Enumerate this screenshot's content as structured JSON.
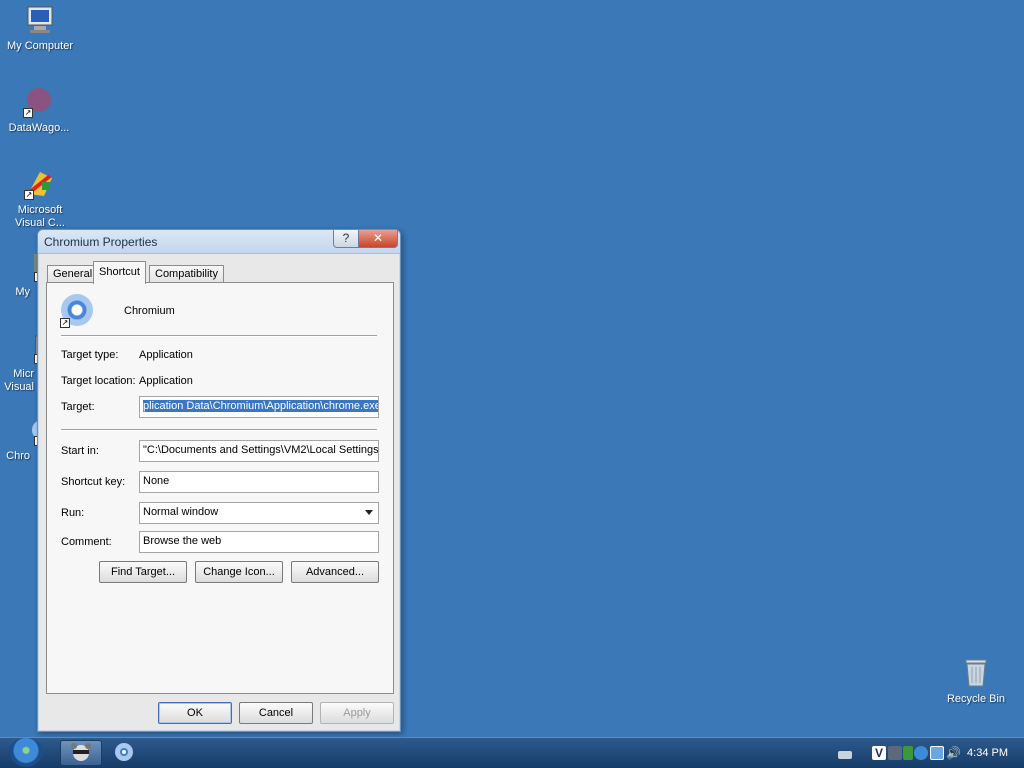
{
  "desktop": {
    "icons": [
      {
        "label": "My Computer",
        "icon": "computer-icon"
      },
      {
        "label": "DataWago...",
        "icon": "datawagon-icon"
      },
      {
        "label": "Microsoft Visual C...",
        "line1": "Microsoft",
        "line2": "Visual C...",
        "icon": "visual-studio-icon"
      },
      {
        "label": "My",
        "icon": "partial-icon"
      },
      {
        "label": "Micr Visual",
        "line1": "Micr",
        "line2": "Visual",
        "icon": "partial-icon"
      },
      {
        "label": "Chro",
        "icon": "chromium-icon"
      },
      {
        "label": "Recycle Bin",
        "icon": "recycle-bin-icon"
      }
    ]
  },
  "dialog": {
    "title": "Chromium Properties",
    "help_glyph": "?",
    "close_glyph": "✕",
    "tabs": [
      {
        "label": "General"
      },
      {
        "label": "Shortcut",
        "active": true
      },
      {
        "label": "Compatibility"
      }
    ],
    "app_name": "Chromium",
    "target_type_label": "Target type:",
    "target_type_value": "Application",
    "target_location_label": "Target location:",
    "target_location_value": "Application",
    "target_label": "Target:",
    "target_value": "plication Data\\Chromium\\Application\\chrome.exe\"",
    "start_in_label": "Start in:",
    "start_in_value": "\"C:\\Documents and Settings\\VM2\\Local Settings",
    "shortcut_key_label": "Shortcut key:",
    "shortcut_key_value": "None",
    "run_label": "Run:",
    "run_value": "Normal window",
    "comment_label": "Comment:",
    "comment_value": "Browse the web",
    "buttons": {
      "find_target": "Find Target...",
      "change_icon": "Change Icon...",
      "advanced": "Advanced...",
      "ok": "OK",
      "cancel": "Cancel",
      "apply": "Apply"
    }
  },
  "taskbar": {
    "clock": "4:34 PM"
  }
}
